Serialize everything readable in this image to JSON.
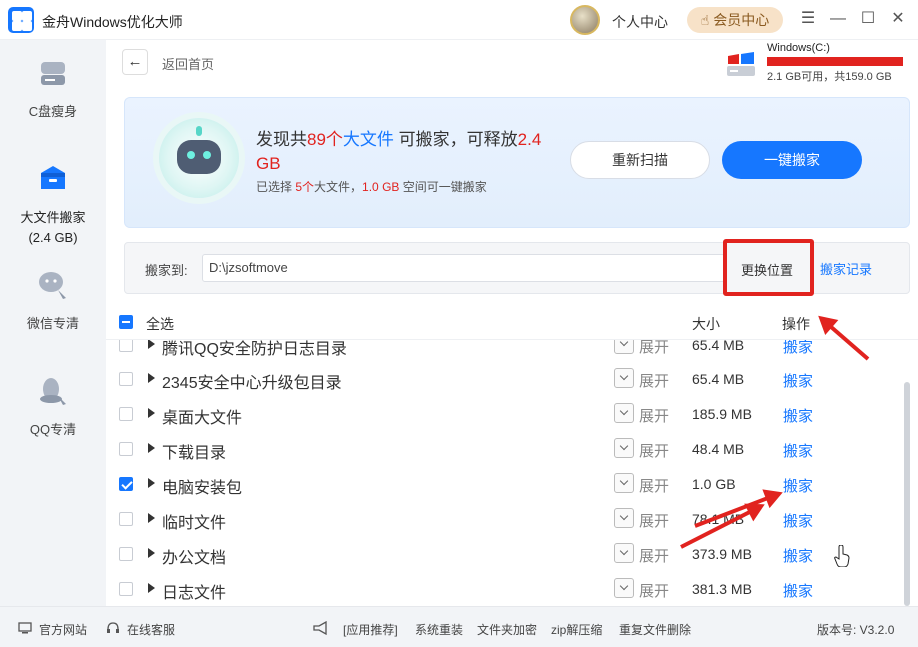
{
  "window": {
    "title": "金舟Windows优化大师",
    "user_center": "个人中心",
    "vip_label": "会员中心",
    "controls": [
      "menu-icon",
      "minimize-icon",
      "maximize-icon",
      "close-icon"
    ]
  },
  "sidebar": {
    "items": [
      {
        "label": "C盘瘦身",
        "icon": "disk-icon",
        "active": false
      },
      {
        "label": "大文件搬家",
        "sub": "(2.4 GB)",
        "icon": "box-icon",
        "active": true
      },
      {
        "label": "微信专清",
        "icon": "wechat-icon",
        "active": false
      },
      {
        "label": "QQ专清",
        "icon": "qq-icon",
        "active": false
      }
    ]
  },
  "header": {
    "back_label": "返回首页",
    "disk_name": "Windows(C:)",
    "disk_info": "2.1 GB可用，共159.0 GB",
    "disk_used_fraction": 0.987
  },
  "banner": {
    "prefix": "发现共",
    "count": "89个",
    "bigfile": "大文件",
    "mid": " 可搬家，可释放",
    "release": "2.4 GB",
    "sub_prefix": "已选择 ",
    "sub_count": "5个",
    "sub_mid": "大文件，",
    "sub_size": "1.0 GB",
    "sub_suffix": " 空间可一键搬家",
    "rescan": "重新扫描",
    "move_all": "一键搬家"
  },
  "destination": {
    "label": "搬家到:",
    "path": "D:\\jzsoftmove",
    "change": "更换位置",
    "history": "搬家记录"
  },
  "table": {
    "select_all": "全选",
    "col_size": "大小",
    "col_op": "操作",
    "expand_label": "展开",
    "op_label": "搬家",
    "rows": [
      {
        "name": "腾讯QQ安全防护日志目录",
        "size": "65.4 MB",
        "checked": false
      },
      {
        "name": "2345安全中心升级包目录",
        "size": "65.4 MB",
        "checked": false
      },
      {
        "name": "桌面大文件",
        "size": "185.9 MB",
        "checked": false
      },
      {
        "name": "下载目录",
        "size": "48.4 MB",
        "checked": false
      },
      {
        "name": "电脑安装包",
        "size": "1.0 GB",
        "checked": true
      },
      {
        "name": "临时文件",
        "size": "78.1 MB",
        "checked": false
      },
      {
        "name": "办公文档",
        "size": "373.9 MB",
        "checked": false
      },
      {
        "name": "日志文件",
        "size": "381.3 MB",
        "checked": false
      }
    ]
  },
  "footer": {
    "website": "官方网站",
    "support": "在线客服",
    "recommend": "[应用推荐]",
    "links": [
      "系统重装",
      "文件夹加密",
      "zip解压缩",
      "重复文件删除"
    ],
    "version": "版本号: V3.2.0"
  },
  "colors": {
    "accent": "#1677ff",
    "highlight": "#e1231f"
  }
}
